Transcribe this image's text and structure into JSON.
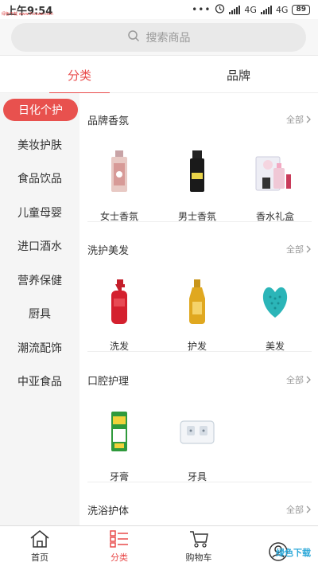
{
  "status_bar": {
    "time": "上午9:54",
    "dots": "•••",
    "network1": "4G",
    "network2": "4G",
    "battery": "89",
    "watermark": "绿色下载 www.7xiazai.com"
  },
  "search": {
    "placeholder": "搜索商品"
  },
  "tabs": [
    {
      "label": "分类",
      "active": true
    },
    {
      "label": "品牌",
      "active": false
    }
  ],
  "sidebar": {
    "items": [
      {
        "label": "日化个护",
        "active": true
      },
      {
        "label": "美妆护肤"
      },
      {
        "label": "食品饮品"
      },
      {
        "label": "儿童母婴"
      },
      {
        "label": "进口酒水"
      },
      {
        "label": "营养保健"
      },
      {
        "label": "厨具"
      },
      {
        "label": "潮流配饰"
      },
      {
        "label": "中亚食品"
      }
    ]
  },
  "sections": [
    {
      "title": "品牌香氛",
      "all_label": "全部",
      "products": [
        {
          "label": "女士香氛"
        },
        {
          "label": "男士香氛"
        },
        {
          "label": "香水礼盒"
        }
      ]
    },
    {
      "title": "洗护美发",
      "all_label": "全部",
      "products": [
        {
          "label": "洗发"
        },
        {
          "label": "护发"
        },
        {
          "label": "美发"
        }
      ]
    },
    {
      "title": "口腔护理",
      "all_label": "全部",
      "products": [
        {
          "label": "牙膏"
        },
        {
          "label": "牙具"
        }
      ]
    },
    {
      "title": "洗浴护体",
      "all_label": "全部",
      "products": []
    }
  ],
  "bottom_nav": [
    {
      "label": "首页",
      "icon": "home-icon"
    },
    {
      "label": "分类",
      "icon": "category-icon",
      "active": true
    },
    {
      "label": "购物车",
      "icon": "cart-icon"
    },
    {
      "label": "",
      "icon": "user-icon"
    }
  ],
  "watermark_bottom": "绿色下载",
  "colors": {
    "accent": "#e94b4b",
    "sidebar_bg": "#f5f5f5"
  }
}
